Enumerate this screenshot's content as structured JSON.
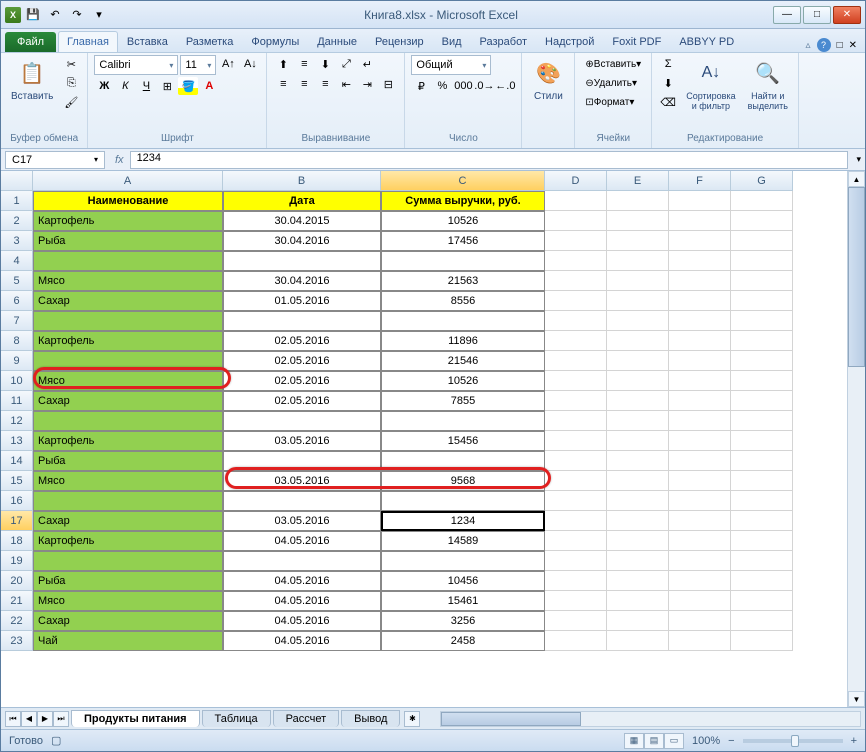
{
  "window": {
    "title": "Книга8.xlsx - Microsoft Excel"
  },
  "qat": {
    "save": "💾",
    "undo": "↶",
    "redo": "↷"
  },
  "tabs": {
    "file": "Файл",
    "items": [
      "Главная",
      "Вставка",
      "Разметка",
      "Формулы",
      "Данные",
      "Рецензир",
      "Вид",
      "Разработ",
      "Надстрой",
      "Foxit PDF",
      "ABBYY PD"
    ],
    "active": 0
  },
  "ribbon": {
    "clipboard": {
      "paste": "Вставить",
      "label": "Буфер обмена"
    },
    "font": {
      "name": "Calibri",
      "size": "11",
      "label": "Шрифт"
    },
    "align": {
      "label": "Выравнивание"
    },
    "number": {
      "format": "Общий",
      "label": "Число"
    },
    "styles": {
      "btn": "Стили",
      "label": ""
    },
    "cells": {
      "insert": "Вставить",
      "delete": "Удалить",
      "format": "Формат",
      "label": "Ячейки"
    },
    "editing": {
      "sort": "Сортировка\nи фильтр",
      "find": "Найти и\nвыделить",
      "label": "Редактирование"
    }
  },
  "formula": {
    "cell": "C17",
    "fx": "fx",
    "value": "1234"
  },
  "columns": [
    "A",
    "B",
    "C",
    "D",
    "E",
    "F",
    "G"
  ],
  "headers": [
    "Наименование",
    "Дата",
    "Сумма выручки, руб."
  ],
  "rows": [
    {
      "n": 1,
      "a": "Наименование",
      "b": "Дата",
      "c": "Сумма выручки, руб.",
      "hdr": true
    },
    {
      "n": 2,
      "a": "Картофель",
      "b": "30.04.2015",
      "c": "10526"
    },
    {
      "n": 3,
      "a": "Рыба",
      "b": "30.04.2016",
      "c": "17456"
    },
    {
      "n": 4,
      "a": "",
      "b": "",
      "c": ""
    },
    {
      "n": 5,
      "a": "Мясо",
      "b": "30.04.2016",
      "c": "21563"
    },
    {
      "n": 6,
      "a": "Сахар",
      "b": "01.05.2016",
      "c": "8556"
    },
    {
      "n": 7,
      "a": "",
      "b": "",
      "c": ""
    },
    {
      "n": 8,
      "a": "Картофель",
      "b": "02.05.2016",
      "c": "11896"
    },
    {
      "n": 9,
      "a": "",
      "b": "02.05.2016",
      "c": "21546"
    },
    {
      "n": 10,
      "a": "Мясо",
      "b": "02.05.2016",
      "c": "10526"
    },
    {
      "n": 11,
      "a": "Сахар",
      "b": "02.05.2016",
      "c": "7855"
    },
    {
      "n": 12,
      "a": "",
      "b": "",
      "c": ""
    },
    {
      "n": 13,
      "a": "Картофель",
      "b": "03.05.2016",
      "c": "15456"
    },
    {
      "n": 14,
      "a": "Рыба",
      "b": "",
      "c": ""
    },
    {
      "n": 15,
      "a": "Мясо",
      "b": "03.05.2016",
      "c": "9568"
    },
    {
      "n": 16,
      "a": "",
      "b": "",
      "c": ""
    },
    {
      "n": 17,
      "a": "Сахар",
      "b": "03.05.2016",
      "c": "1234",
      "active": true
    },
    {
      "n": 18,
      "a": "Картофель",
      "b": "04.05.2016",
      "c": "14589"
    },
    {
      "n": 19,
      "a": "",
      "b": "",
      "c": ""
    },
    {
      "n": 20,
      "a": "Рыба",
      "b": "04.05.2016",
      "c": "10456"
    },
    {
      "n": 21,
      "a": "Мясо",
      "b": "04.05.2016",
      "c": "15461"
    },
    {
      "n": 22,
      "a": "Сахар",
      "b": "04.05.2016",
      "c": "3256"
    },
    {
      "n": 23,
      "a": "Чай",
      "b": "04.05.2016",
      "c": "2458"
    }
  ],
  "sheets": {
    "active": "Продукты питания",
    "others": [
      "Таблица",
      "Рассчет",
      "Вывод"
    ]
  },
  "status": {
    "ready": "Готово",
    "zoom": "100%"
  }
}
